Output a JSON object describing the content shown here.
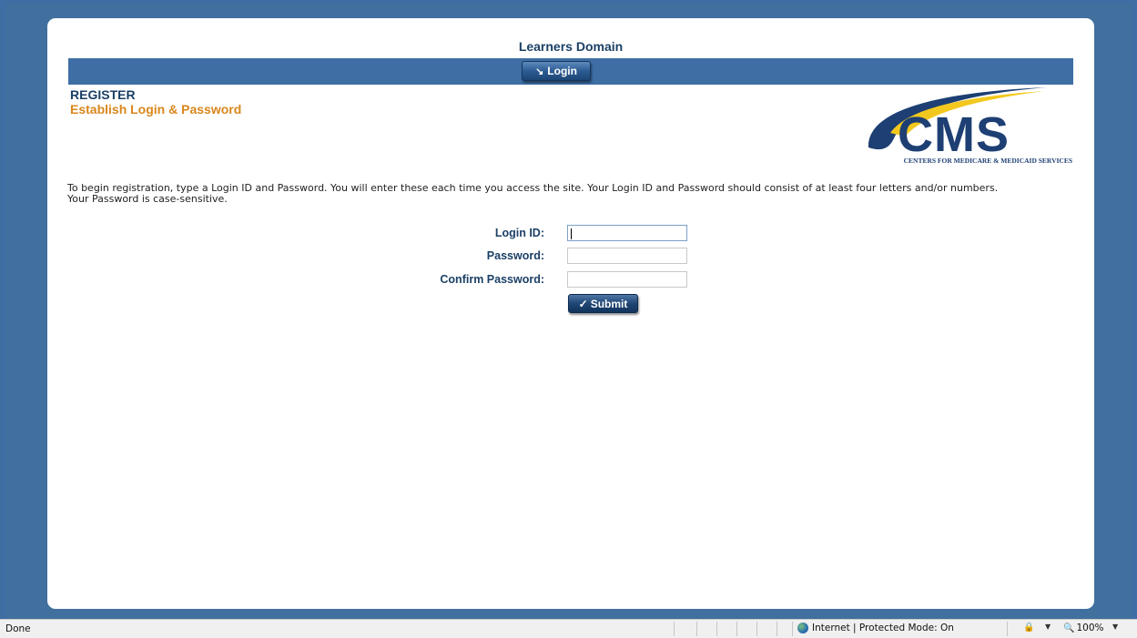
{
  "site": {
    "title": "Learners Domain"
  },
  "nav": {
    "login_label": "Login"
  },
  "register": {
    "title": "REGISTER",
    "subtitle": "Establish Login & Password",
    "intro_line1": "To begin registration, type a Login ID and Password. You will enter these each time you access the site. Your Login ID and Password should consist of at least four letters and/or numbers.",
    "intro_line2": "Your Password is case-sensitive."
  },
  "logo": {
    "text": "CMS",
    "tagline": "CENTERS FOR MEDICARE & MEDICAID SERVICES",
    "colors": {
      "navy": "#1d3f73",
      "gold": "#f2c81e"
    }
  },
  "form": {
    "login_id_label": "Login ID:",
    "login_id_value": "",
    "password_label": "Password:",
    "password_value": "",
    "confirm_label": "Confirm Password:",
    "confirm_value": "",
    "submit_label": "Submit"
  },
  "status_bar": {
    "status": "Done",
    "zone": "Internet | Protected Mode: On",
    "zoom": "100%"
  },
  "colors": {
    "frame_blue": "#3e6ea4",
    "heading_navy": "#1b4066",
    "subtitle_orange": "#d9861b"
  },
  "icons": {
    "login": "login-arrow-icon",
    "submit": "checkmark-icon",
    "zone": "globe-icon",
    "zoom": "magnifier-icon"
  }
}
